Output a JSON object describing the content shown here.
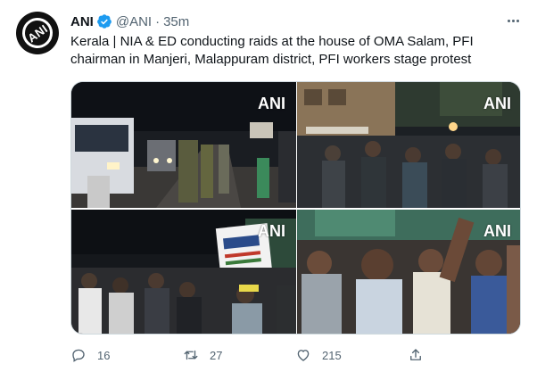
{
  "tweet": {
    "author_name": "ANI",
    "handle": "@ANI",
    "separator": "·",
    "time": "35m",
    "avatar_text": "ANI",
    "text": "Kerala | NIA & ED conducting raids at the house of OMA Salam, PFI chairman in Manjeri, Malappuram district, PFI workers stage protest"
  },
  "media": {
    "watermark": "ANI",
    "photos": [
      {
        "name": "photo-police-vehicles-night"
      },
      {
        "name": "photo-crowd-gathering"
      },
      {
        "name": "photo-protest-placard"
      },
      {
        "name": "photo-protesters-shouting"
      }
    ]
  },
  "actions": {
    "replies": "16",
    "retweets": "27",
    "likes": "215"
  },
  "colors": {
    "verified": "#1d9bf0",
    "secondary_text": "#536471"
  }
}
